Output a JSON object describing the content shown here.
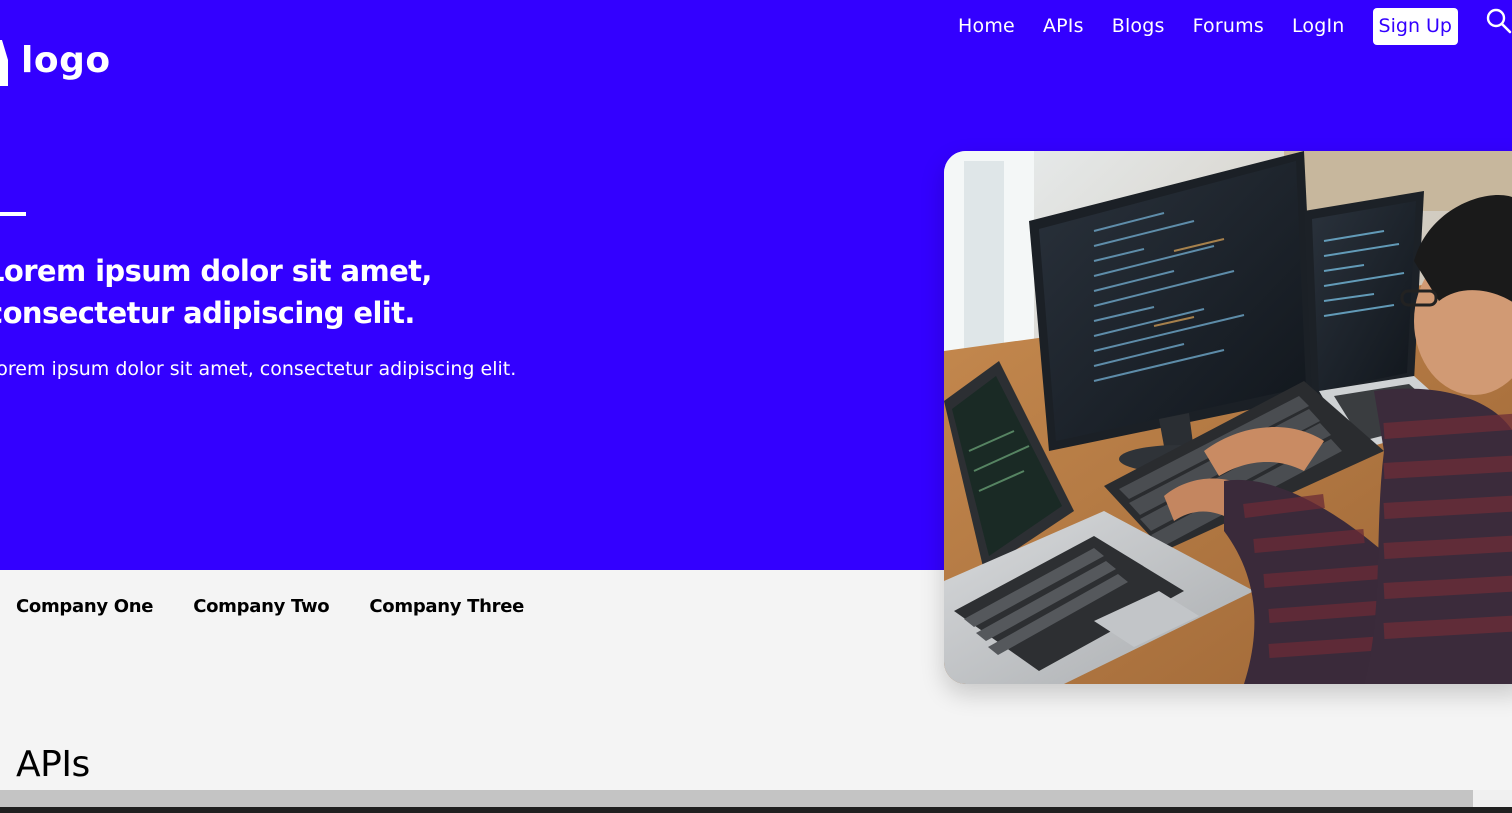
{
  "brand": {
    "logo_text": "logo",
    "primary_color": "#3300ff"
  },
  "nav": {
    "items": [
      {
        "label": "Home"
      },
      {
        "label": "APIs"
      },
      {
        "label": "Blogs"
      },
      {
        "label": "Forums"
      },
      {
        "label": "LogIn"
      }
    ],
    "signup_label": "Sign Up",
    "search_icon": "search-icon"
  },
  "hero": {
    "title": "Lorem ipsum dolor sit amet, consectetur adipiscing elit.",
    "subtitle": "Lorem ipsum dolor sit amet, consectetur adipiscing elit.",
    "image": "developer-at-computers-photo"
  },
  "companies": [
    {
      "name": "Company One"
    },
    {
      "name": "Company Two"
    },
    {
      "name": "Company Three"
    }
  ],
  "section": {
    "title": "APIs"
  }
}
